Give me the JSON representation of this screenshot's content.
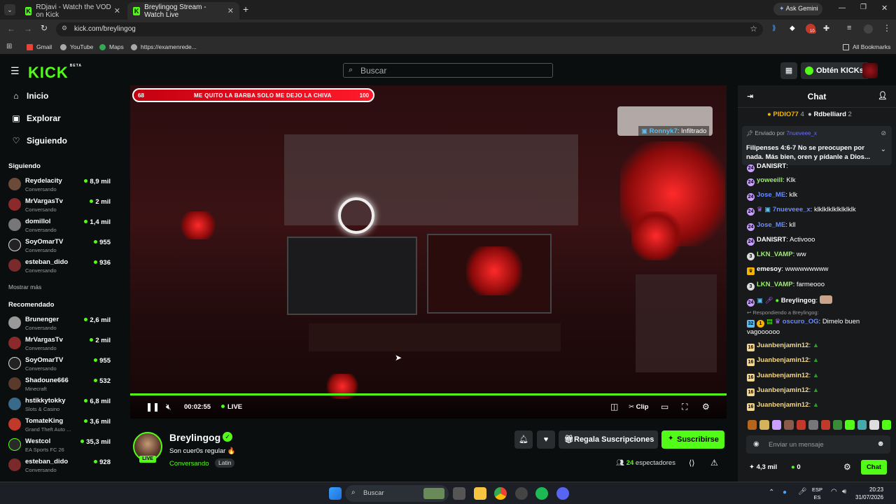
{
  "browser": {
    "tabs": [
      {
        "label": "RDjavi - Watch the VOD on Kick",
        "active": false
      },
      {
        "label": "Breylingog Stream - Watch Live",
        "active": true
      }
    ],
    "ask_gemini": "Ask Gemini",
    "url": "kick.com/breylingog",
    "bookmarks": [
      "Gmail",
      "YouTube",
      "Maps",
      "https://examenrede..."
    ],
    "all_bookmarks": "All Bookmarks",
    "extension_badge": "10"
  },
  "header": {
    "logo": "KICK",
    "logo_beta": "BETA",
    "search_placeholder": "Buscar",
    "get_kicks": "Obtén KICKs"
  },
  "sidebar": {
    "nav": [
      {
        "label": "Inicio",
        "icon": "home-icon"
      },
      {
        "label": "Explorar",
        "icon": "compass-icon"
      },
      {
        "label": "Siguiendo",
        "icon": "heart-icon"
      }
    ],
    "following_title": "Siguiendo",
    "following": [
      {
        "name": "Reydelacity",
        "category": "Conversando",
        "viewers": "8,9 mil"
      },
      {
        "name": "MrVargasTv",
        "category": "Conversando",
        "viewers": "2 mil"
      },
      {
        "name": "domillol",
        "category": "Conversando",
        "viewers": "1,4 mil"
      },
      {
        "name": "SoyOmarTV",
        "category": "Conversando",
        "viewers": "955"
      },
      {
        "name": "esteban_dido",
        "category": "Conversando",
        "viewers": "936"
      }
    ],
    "show_more": "Mostrar más",
    "recommended_title": "Recomendado",
    "recommended": [
      {
        "name": "Brunenger",
        "category": "Conversando",
        "viewers": "2,6 mil"
      },
      {
        "name": "MrVargasTv",
        "category": "Conversando",
        "viewers": "2 mil"
      },
      {
        "name": "SoyOmarTV",
        "category": "Conversando",
        "viewers": "955"
      },
      {
        "name": "Shadoune666",
        "category": "Minecraft",
        "viewers": "532"
      },
      {
        "name": "hstikkytokky",
        "category": "Slots & Casino",
        "viewers": "6,8 mil"
      },
      {
        "name": "TomateKing",
        "category": "Grand Theft Auto ...",
        "viewers": "3,6 mil"
      },
      {
        "name": "Westcol",
        "category": "EA Sports FC 26",
        "viewers": "35,3 mil"
      },
      {
        "name": "esteban_dido",
        "category": "Conversando",
        "viewers": "928"
      }
    ]
  },
  "video": {
    "banner_left": "68",
    "banner_text": "ME QUITO LA BARBA SOLO ME DEJO LA CHIVA",
    "banner_right": "100",
    "overlay_user": "Ronnyk7",
    "overlay_text": ": Infiltrado",
    "elapsed": "00:02:55",
    "live_label": "LIVE",
    "clip_label": "Clip"
  },
  "stream": {
    "name": "Breylingog",
    "live_badge": "LIVE",
    "title": "Son cuer0s regular 🔥",
    "category": "Conversando",
    "tag": "Latin",
    "gift_label": "Regala Suscripciones",
    "subscribe_label": "Suscribirse",
    "viewers_count": "24",
    "viewers_label": "espectadores"
  },
  "chat": {
    "title": "Chat",
    "leaderboard": [
      {
        "name": "PIDIO77",
        "count": "4"
      },
      {
        "name": "Rdbelliard",
        "count": "2"
      }
    ],
    "pinned_by_label": "Enviado por",
    "pinned_by_user": "7nueveee_x",
    "pinned_message": "Filipenses 4:6-7 No se preocupen por nada. Más bien, oren y pídanle a Dios...",
    "messages": [
      {
        "user": "DANISRT",
        "text": ":",
        "color": "#ffffff"
      },
      {
        "user": "yoweeill",
        "text": ": Klk",
        "color": "#9cf06b"
      },
      {
        "user": "Jose_ME",
        "text": ": klk",
        "color": "#6a8cff"
      },
      {
        "user": "7nueveee_x",
        "text": ": klklklklklklklklk",
        "color": "#6a8cff"
      },
      {
        "user": "Jose_ME",
        "text": ": kll",
        "color": "#6a8cff"
      },
      {
        "user": "DANISRT",
        "text": ": Activooo",
        "color": "#ffffff"
      },
      {
        "user": "LKN_VAMP",
        "text": ": ww",
        "color": "#9cf06b"
      },
      {
        "user": "emesoy",
        "text": ": wwwwwwwww",
        "color": "#ffffff"
      },
      {
        "user": "LKN_VAMP",
        "text": ": farmeooo",
        "color": "#9cf06b"
      },
      {
        "user": "Breylingog",
        "text": ":",
        "color": "#ffffff"
      }
    ],
    "reply_label": "Respondiendo a Breylingog:",
    "reply_user": "oscuro_OG",
    "reply_text": ": Dimelo buen",
    "reply_text2": "vagoooooo",
    "spam_user": "Juanbenjamin12",
    "spam_count": 5,
    "input_placeholder": "Enviar un mensaje",
    "kicks_amount": "4,3 mil",
    "kicks_secondary": "0",
    "send_label": "Chat"
  },
  "taskbar": {
    "search_placeholder": "Buscar",
    "lang_top": "ESP",
    "lang_bottom": "ES",
    "time": "20:23",
    "date": "31/07/2026"
  },
  "colors": {
    "accent": "#53fc18",
    "chat_bg": "#17191b",
    "page_bg": "#0b0e0f"
  }
}
